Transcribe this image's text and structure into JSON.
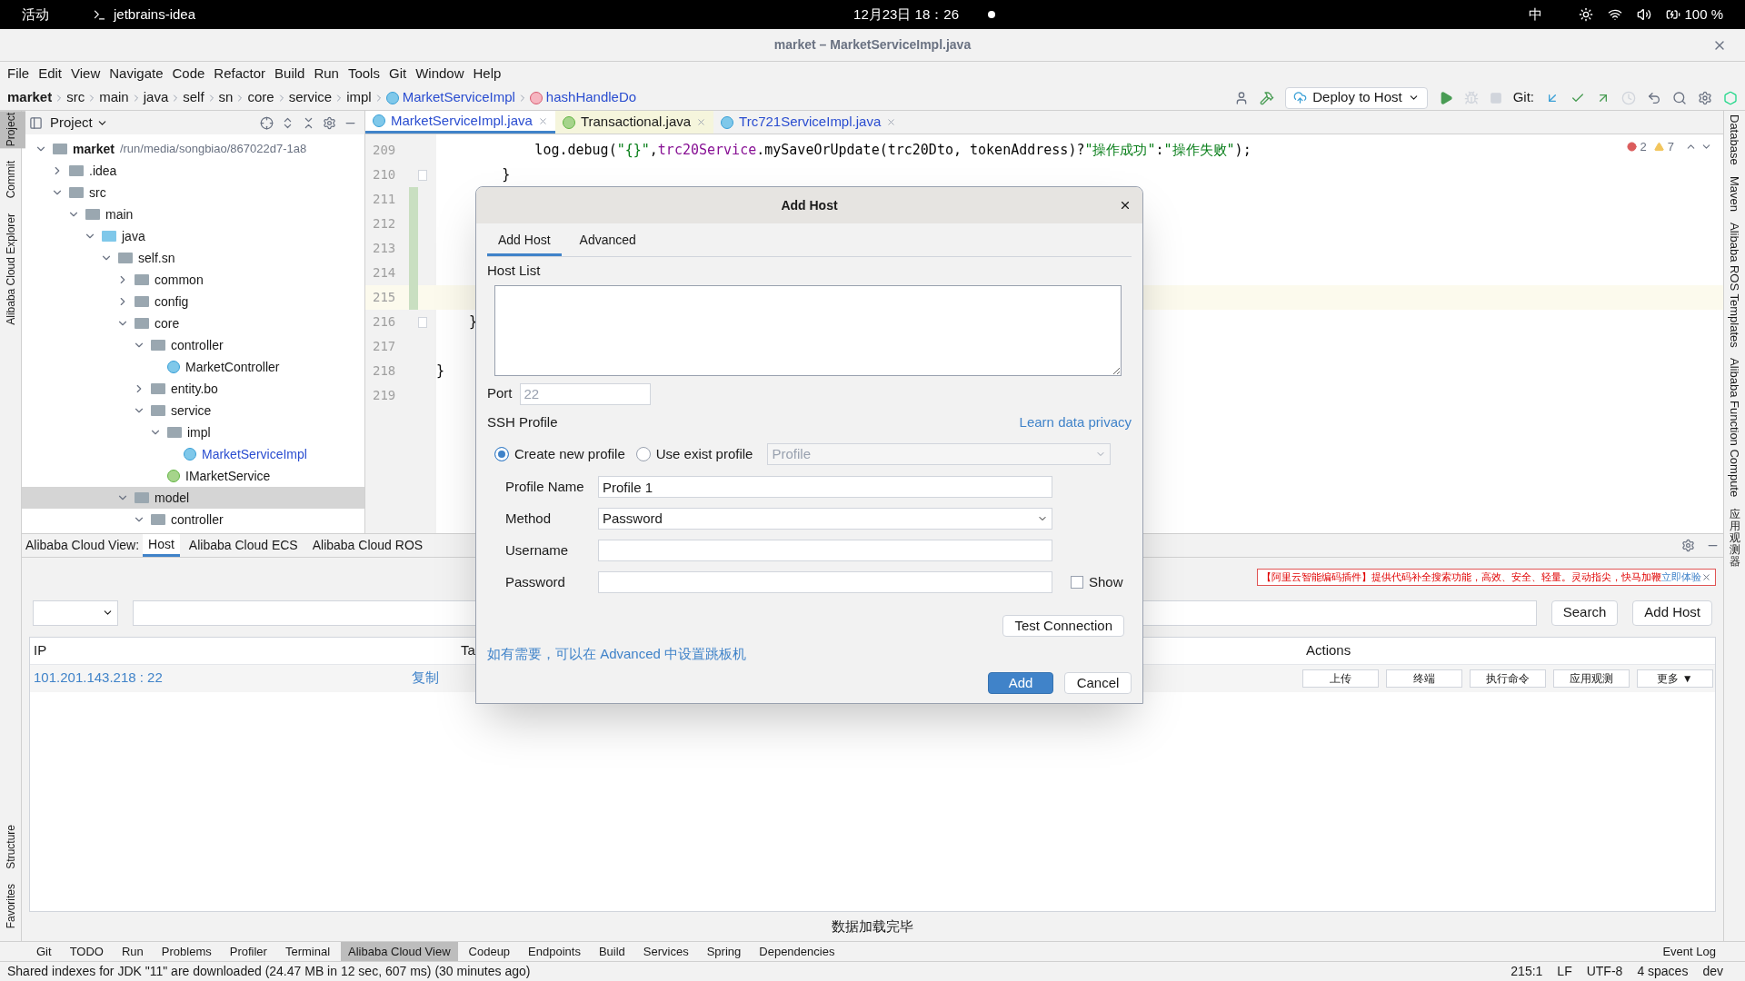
{
  "system_bar": {
    "activities": "活动",
    "app": "jetbrains-idea",
    "clock": "12月23日 18：26",
    "input_method": "中",
    "battery": "100 %"
  },
  "window": {
    "title": "market – MarketServiceImpl.java"
  },
  "menu": [
    "File",
    "Edit",
    "View",
    "Navigate",
    "Code",
    "Refactor",
    "Build",
    "Run",
    "Tools",
    "Git",
    "Window",
    "Help"
  ],
  "breadcrumb": [
    {
      "label": "market",
      "kind": "project"
    },
    {
      "label": "src",
      "kind": "dir"
    },
    {
      "label": "main",
      "kind": "dir"
    },
    {
      "label": "java",
      "kind": "dir"
    },
    {
      "label": "self",
      "kind": "dir"
    },
    {
      "label": "sn",
      "kind": "dir"
    },
    {
      "label": "core",
      "kind": "dir"
    },
    {
      "label": "service",
      "kind": "dir"
    },
    {
      "label": "impl",
      "kind": "dir"
    },
    {
      "label": "MarketServiceImpl",
      "kind": "class"
    },
    {
      "label": "hashHandleDo",
      "kind": "method"
    }
  ],
  "toolbar": {
    "deploy": "Deploy to Host",
    "git_label": "Git:"
  },
  "left_strip_top": [
    {
      "label": "Project",
      "selected": true
    },
    {
      "label": "Commit",
      "selected": false
    },
    {
      "label": "Alibaba Cloud Explorer",
      "selected": false
    }
  ],
  "left_strip_bottom": [
    {
      "label": "Structure",
      "selected": false
    },
    {
      "label": "Favorites",
      "selected": false
    }
  ],
  "project_panel": {
    "title": "Project",
    "tree": [
      {
        "name": "market",
        "path": "/run/media/songbiao/867022d7-1a8",
        "kind": "module",
        "expanded": true,
        "selected": false,
        "children": [
          {
            "name": ".idea",
            "kind": "folder",
            "expanded": false,
            "selected": false
          },
          {
            "name": "src",
            "kind": "folder",
            "expanded": true,
            "selected": false,
            "children": [
              {
                "name": "main",
                "kind": "folder",
                "expanded": true,
                "selected": false,
                "children": [
                  {
                    "name": "java",
                    "kind": "source",
                    "expanded": true,
                    "selected": false,
                    "children": [
                      {
                        "name": "self.sn",
                        "kind": "package",
                        "expanded": true,
                        "selected": false,
                        "children": [
                          {
                            "name": "common",
                            "kind": "package",
                            "expanded": false,
                            "selected": false
                          },
                          {
                            "name": "config",
                            "kind": "package",
                            "expanded": false,
                            "selected": false
                          },
                          {
                            "name": "core",
                            "kind": "package",
                            "expanded": true,
                            "selected": false,
                            "children": [
                              {
                                "name": "controller",
                                "kind": "package",
                                "expanded": true,
                                "selected": false,
                                "children": [
                                  {
                                    "name": "MarketController",
                                    "kind": "class",
                                    "selected": false,
                                    "open": false
                                  }
                                ]
                              },
                              {
                                "name": "entity.bo",
                                "kind": "package",
                                "expanded": false,
                                "selected": false
                              },
                              {
                                "name": "service",
                                "kind": "package",
                                "expanded": true,
                                "selected": false,
                                "children": [
                                  {
                                    "name": "impl",
                                    "kind": "package",
                                    "expanded": true,
                                    "selected": false,
                                    "children": [
                                      {
                                        "name": "MarketServiceImpl",
                                        "kind": "class",
                                        "selected": false,
                                        "open": true
                                      }
                                    ]
                                  },
                                  {
                                    "name": "IMarketService",
                                    "kind": "interface",
                                    "selected": false,
                                    "open": false
                                  }
                                ]
                              }
                            ]
                          },
                          {
                            "name": "model",
                            "kind": "package",
                            "expanded": true,
                            "selected": true,
                            "children": [
                              {
                                "name": "controller",
                                "kind": "package",
                                "expanded": true,
                                "selected": false
                              }
                            ]
                          }
                        ]
                      }
                    ]
                  }
                ]
              }
            ]
          }
        ]
      }
    ]
  },
  "editor": {
    "tabs": [
      {
        "label": "MarketServiceImpl.java",
        "kind": "class",
        "selected": true
      },
      {
        "label": "Transactional.java",
        "kind": "annotation",
        "selected": false
      },
      {
        "label": "Trc721ServiceImpl.java",
        "kind": "class",
        "selected": false
      }
    ],
    "errors": "2",
    "warnings": "7",
    "lines": [
      {
        "number": "209",
        "changed": false,
        "current": false,
        "fold": false,
        "segments": [
          {
            "kind": "plain",
            "text": "            log.debug("
          },
          {
            "kind": "string",
            "text": "\"{}\""
          },
          {
            "kind": "plain",
            "text": ","
          },
          {
            "kind": "field",
            "text": "trc20Service"
          },
          {
            "kind": "plain",
            "text": ".mySaveOrUpdate(trc20Dto, tokenAddress)?"
          },
          {
            "kind": "string",
            "text": "\"操作成功\""
          },
          {
            "kind": "plain",
            "text": ":"
          },
          {
            "kind": "string",
            "text": "\"操作失败\""
          },
          {
            "kind": "plain",
            "text": ");"
          }
        ]
      },
      {
        "number": "210",
        "changed": false,
        "current": false,
        "fold": true,
        "segments": [
          {
            "kind": "plain",
            "text": "        }"
          }
        ]
      },
      {
        "number": "211",
        "changed": true,
        "current": false,
        "fold": false
      },
      {
        "number": "212",
        "changed": true,
        "current": false,
        "fold": false
      },
      {
        "number": "213",
        "changed": true,
        "current": false,
        "fold": false
      },
      {
        "number": "214",
        "changed": true,
        "current": false,
        "fold": false
      },
      {
        "number": "215",
        "changed": true,
        "current": true,
        "fold": false
      },
      {
        "number": "216",
        "changed": false,
        "current": false,
        "fold": true,
        "segments": [
          {
            "kind": "plain",
            "text": "    }"
          }
        ]
      },
      {
        "number": "217",
        "changed": false,
        "current": false,
        "fold": false
      },
      {
        "number": "218",
        "changed": false,
        "current": false,
        "fold": false,
        "segments": [
          {
            "kind": "plain",
            "text": "}"
          }
        ]
      },
      {
        "number": "219",
        "changed": false,
        "current": false,
        "fold": false
      }
    ]
  },
  "right_strip": [
    "Database",
    "Maven",
    "Alibaba ROS Templates",
    "Alibaba Function Compute",
    "应用观测器"
  ],
  "cloud_view": {
    "label": "Alibaba Cloud View:",
    "tabs": [
      {
        "label": "Host",
        "selected": true
      },
      {
        "label": "Alibaba Cloud ECS",
        "selected": false
      },
      {
        "label": "Alibaba Cloud ROS",
        "selected": false
      }
    ],
    "banner": {
      "text": "【阿里云智能编码插件】提供代码补全搜索功能，高效、安全、轻量。灵动指尖，快马加鞭",
      "link": "立即体验"
    },
    "search_button": "Search",
    "add_host_button": "Add Host",
    "columns": [
      "IP",
      "Ta",
      "Actions"
    ],
    "rows": [
      {
        "ip": "101.201.143.218 : 22",
        "copy": "复制",
        "actions": [
          "上传",
          "终端",
          "执行命令",
          "应用观测",
          "更多 ▼"
        ]
      }
    ],
    "status": "数据加载完毕"
  },
  "dialog": {
    "title": "Add Host",
    "tabs": [
      {
        "label": "Add Host",
        "selected": true
      },
      {
        "label": "Advanced",
        "selected": false
      }
    ],
    "host_list_label": "Host List",
    "port_label": "Port",
    "port_placeholder": "22",
    "ssh_profile_label": "SSH Profile",
    "privacy_link": "Learn data privacy",
    "profile_options": [
      {
        "label": "Create new profile",
        "selected": true
      },
      {
        "label": "Use exist profile",
        "selected": false
      }
    ],
    "profile_select": {
      "value": "Profile",
      "disabled": true
    },
    "profile_name_label": "Profile Name",
    "profile_name": "Profile 1",
    "method_label": "Method",
    "method": "Password",
    "username_label": "Username",
    "password_label": "Password",
    "show": {
      "label": "Show",
      "checked": false
    },
    "test_button": "Test Connection",
    "hint": "如有需要，可以在 Advanced 中设置跳板机",
    "add_button": "Add",
    "cancel_button": "Cancel"
  },
  "tool_windows": [
    {
      "label": "Git",
      "selected": false
    },
    {
      "label": "TODO",
      "selected": false
    },
    {
      "label": "Run",
      "selected": false
    },
    {
      "label": "Problems",
      "selected": false
    },
    {
      "label": "Profiler",
      "selected": false
    },
    {
      "label": "Terminal",
      "selected": false
    },
    {
      "label": "Alibaba Cloud View",
      "selected": true
    },
    {
      "label": "Codeup",
      "selected": false
    },
    {
      "label": "Endpoints",
      "selected": false
    },
    {
      "label": "Build",
      "selected": false
    },
    {
      "label": "Services",
      "selected": false
    },
    {
      "label": "Spring",
      "selected": false
    },
    {
      "label": "Dependencies",
      "selected": false
    }
  ],
  "event_log": "Event Log",
  "status_bar": {
    "message": "Shared indexes for JDK \"11\" are downloaded (24.47 MB in 12 sec, 607 ms) (30 minutes ago)",
    "items": [
      "215:1",
      "LF",
      "UTF-8",
      "4 spaces",
      "dev"
    ]
  }
}
